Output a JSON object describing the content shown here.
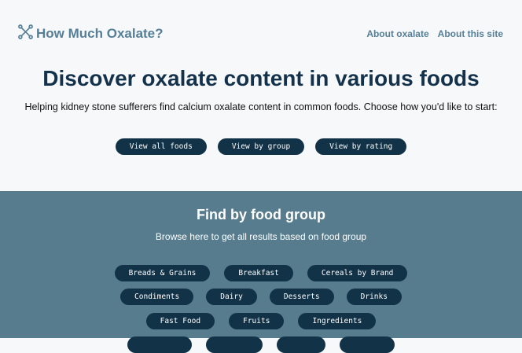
{
  "header": {
    "brand": "How Much Oxalate?",
    "links": [
      "About oxalate",
      "About this site"
    ]
  },
  "hero": {
    "title": "Discover oxalate content in various foods",
    "subtitle": "Helping kidney stone sufferers find calcium oxalate content in common foods. Choose how you'd like to start:",
    "buttons": [
      "View all foods",
      "View by group",
      "View by rating"
    ]
  },
  "groups": {
    "title": "Find by food group",
    "subtitle": "Browse here to get all results based on food group",
    "row1": [
      "Breads & Grains",
      "Breakfast",
      "Cereals by Brand"
    ],
    "row2": [
      "Condiments",
      "Dairy",
      "Desserts",
      "Drinks"
    ],
    "row3": [
      "Fast Food",
      "Fruits",
      "Ingredients"
    ]
  },
  "colors": {
    "primary": "#123247",
    "accent": "#557f97",
    "band": "#567c8d"
  }
}
